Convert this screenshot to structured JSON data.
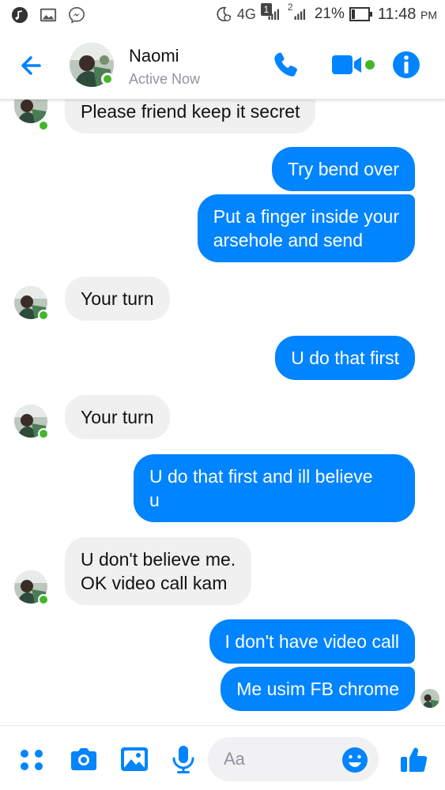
{
  "status_bar": {
    "network": "4G",
    "sim1_badge": "1",
    "sim2_badge": "2",
    "battery": "21%",
    "time": "11:48",
    "ampm": "PM"
  },
  "header": {
    "contact_name": "Naomi",
    "contact_status": "Active Now"
  },
  "messages": [
    {
      "side": "in",
      "lines": [
        "Please friend keep it secret"
      ]
    },
    {
      "side": "out",
      "lines": [
        "Try bend over"
      ]
    },
    {
      "side": "out",
      "lines": [
        "Put a finger inside your",
        "arsehole and send"
      ]
    },
    {
      "side": "in",
      "lines": [
        "Your turn"
      ]
    },
    {
      "side": "out",
      "lines": [
        "U do that first"
      ]
    },
    {
      "side": "in",
      "lines": [
        "Your turn"
      ]
    },
    {
      "side": "out",
      "lines": [
        "U do that first and ill believe",
        "u"
      ]
    },
    {
      "side": "in",
      "lines": [
        "U don't believe me.",
        "OK video call kam"
      ]
    },
    {
      "side": "out",
      "lines": [
        "I don't have video call"
      ]
    },
    {
      "side": "out",
      "lines": [
        "Me usim FB chrome"
      ]
    }
  ],
  "composer": {
    "placeholder": "Aa"
  },
  "colors": {
    "accent": "#0084ff",
    "incoming_bubble": "#f1f0f0",
    "online": "#42b72a",
    "secondary_text": "#90949c"
  },
  "icons": [
    "music-icon",
    "gallery-icon",
    "messenger-icon",
    "alarm-icon",
    "signal-icon",
    "battery-icon",
    "back-arrow-icon",
    "phone-icon",
    "video-camera-icon",
    "info-icon",
    "more-grid-icon",
    "camera-icon",
    "image-icon",
    "microphone-icon",
    "emoji-icon",
    "thumbs-up-icon"
  ]
}
